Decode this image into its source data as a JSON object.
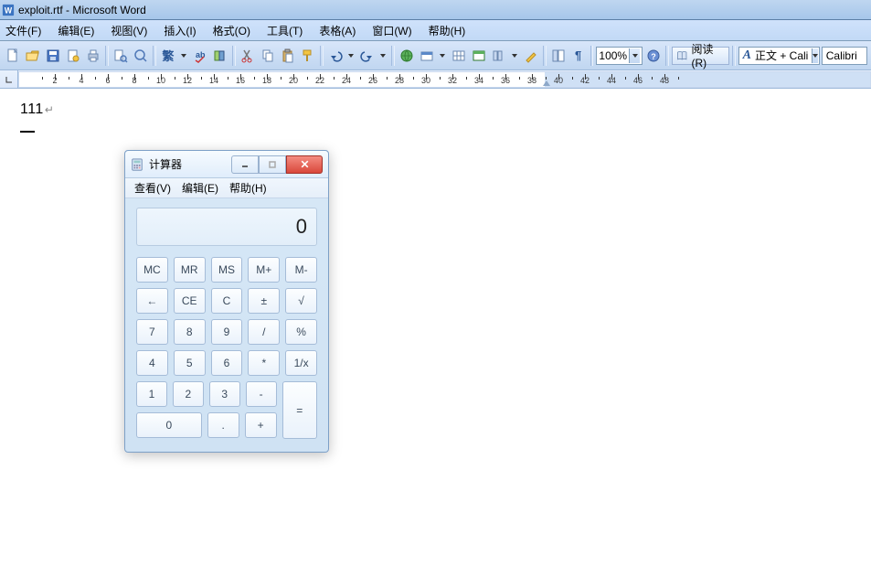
{
  "word": {
    "title": "exploit.rtf - Microsoft Word",
    "menus": [
      "文件(F)",
      "编辑(E)",
      "视图(V)",
      "插入(I)",
      "格式(O)",
      "工具(T)",
      "表格(A)",
      "窗口(W)",
      "帮助(H)"
    ],
    "zoom": "100%",
    "read_label": "阅读(R)",
    "style_label": "正文 + Cali",
    "style_prefix_icon": "A",
    "font_label": "Calibri",
    "ruler_ticks": [
      2,
      4,
      6,
      8,
      10,
      12,
      14,
      16,
      18,
      20,
      22,
      24,
      26,
      28,
      30,
      32,
      34,
      36,
      38,
      40,
      42,
      44,
      46,
      48
    ],
    "doc_text": "111"
  },
  "calc": {
    "title": "计算器",
    "menus": [
      "查看(V)",
      "编辑(E)",
      "帮助(H)"
    ],
    "display": "0",
    "row_mem": [
      "MC",
      "MR",
      "MS",
      "M+",
      "M-"
    ],
    "row_a": [
      "←",
      "CE",
      "C",
      "±",
      "√"
    ],
    "row_b": [
      "7",
      "8",
      "9",
      "/",
      "%"
    ],
    "row_c": [
      "4",
      "5",
      "6",
      "*",
      "1/x"
    ],
    "row_d": [
      "1",
      "2",
      "3",
      "-"
    ],
    "row_e": [
      "0",
      ".",
      "+"
    ],
    "equals": "="
  }
}
